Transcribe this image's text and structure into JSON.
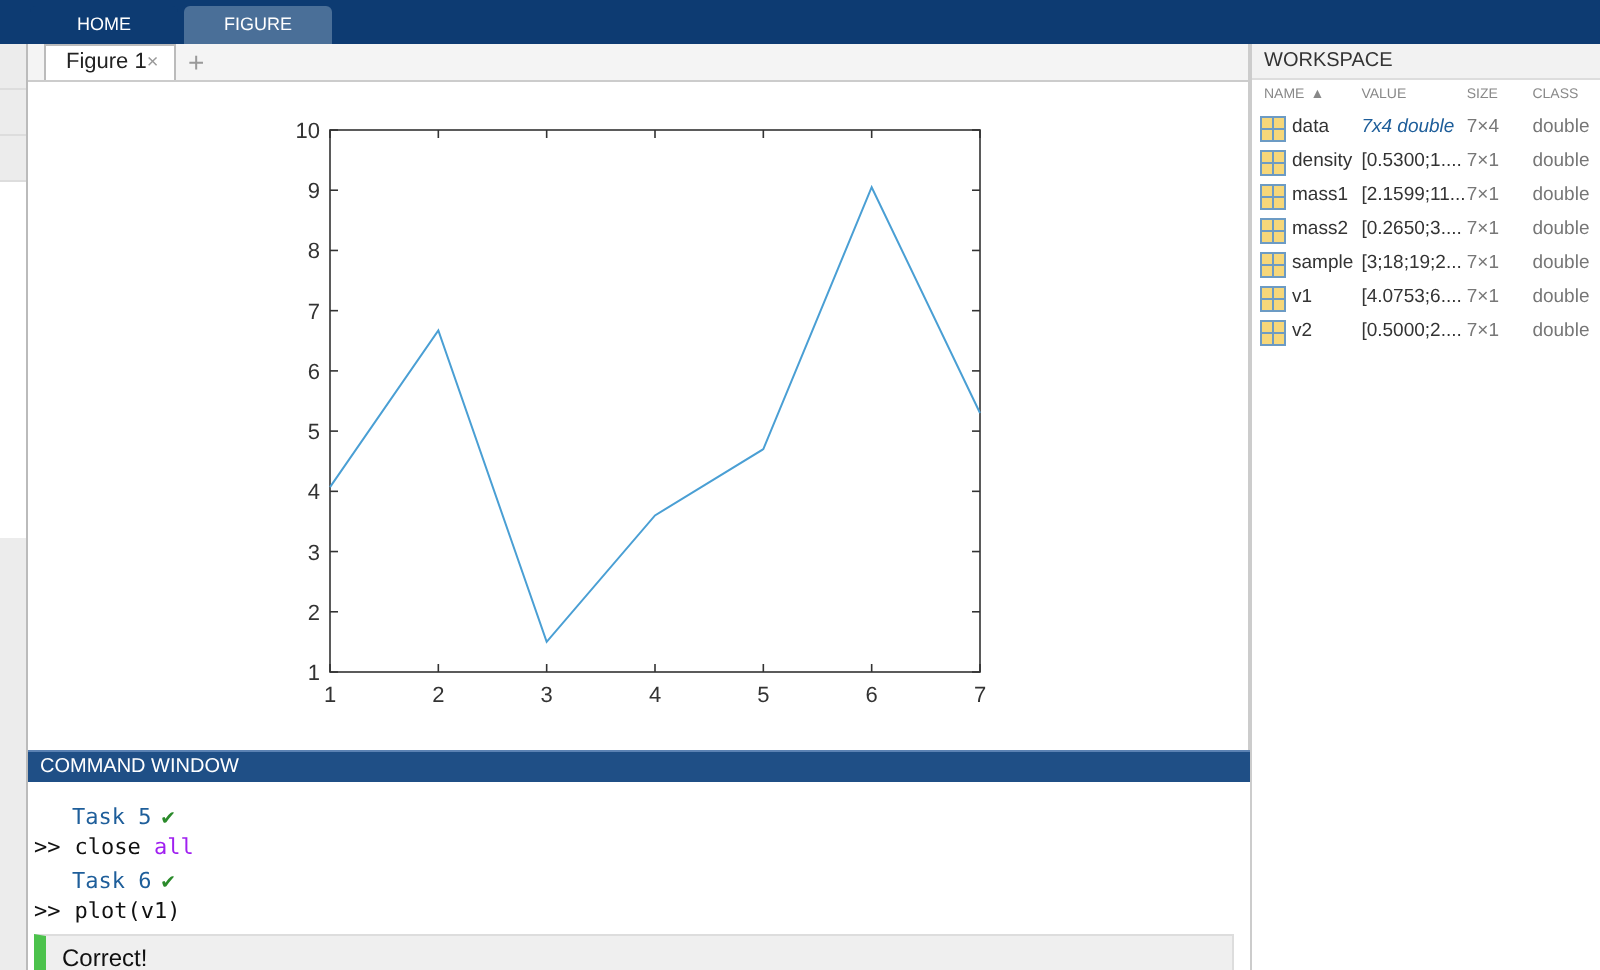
{
  "ribbon_tabs": [
    {
      "label": "HOME",
      "selected": false
    },
    {
      "label": "FIGURE",
      "selected": true
    }
  ],
  "figure_tabs": [
    {
      "label": "Figure 1",
      "selected": true,
      "close": "×"
    }
  ],
  "new_tab": "+",
  "figure": {
    "chart_data": {
      "type": "line",
      "x": [
        1,
        2,
        3,
        4,
        5,
        6,
        7
      ],
      "series": [
        {
          "color": "#4a9fd4",
          "values": [
            4.07,
            6.67,
            1.5,
            3.6,
            4.7,
            9.05,
            5.3
          ]
        }
      ],
      "xlim": [
        1,
        7
      ],
      "ylim": [
        1,
        10
      ],
      "xticks": [
        1,
        2,
        3,
        4,
        5,
        6,
        7
      ],
      "yticks": [
        1,
        2,
        3,
        4,
        5,
        6,
        7,
        8,
        9,
        10
      ]
    }
  },
  "command_window": {
    "title": "COMMAND WINDOW",
    "lines": [
      {
        "kind": "task",
        "text": "Task 5",
        "done": true,
        "mark": "✔"
      },
      {
        "kind": "command",
        "prompt": ">>",
        "segments": [
          {
            "text": "close",
            "kind": "plain"
          },
          {
            "text": "all",
            "kind": "keyword"
          }
        ]
      },
      {
        "kind": "task",
        "text": "Task 6",
        "done": true,
        "mark": "✔"
      },
      {
        "kind": "command",
        "prompt": ">>",
        "segments": [
          {
            "text": "plot(v1)",
            "kind": "plain"
          }
        ]
      }
    ],
    "feedback": {
      "text": "Correct!",
      "success": true
    }
  },
  "workspace": {
    "title": "WORKSPACE",
    "columns": [
      {
        "label": "NAME",
        "sort": "▲"
      },
      {
        "label": "VALUE"
      },
      {
        "label": "SIZE"
      },
      {
        "label": "CLASS"
      }
    ],
    "rows": [
      {
        "name": "data",
        "value": "7x4 double",
        "kind": "summary",
        "size": "7×4",
        "class": "double"
      },
      {
        "name": "density",
        "value": "[0.5300;1....",
        "kind": "array",
        "size": "7×1",
        "class": "double"
      },
      {
        "name": "mass1",
        "value": "[2.1599;11...",
        "kind": "array",
        "size": "7×1",
        "class": "double"
      },
      {
        "name": "mass2",
        "value": "[0.2650;3....",
        "kind": "array",
        "size": "7×1",
        "class": "double"
      },
      {
        "name": "sample",
        "value": "[3;18;19;2...",
        "kind": "array",
        "size": "7×1",
        "class": "double"
      },
      {
        "name": "v1",
        "value": "[4.0753;6....",
        "kind": "array",
        "size": "7×1",
        "class": "double"
      },
      {
        "name": "v2",
        "value": "[0.5000;2....",
        "kind": "array",
        "size": "7×1",
        "class": "double"
      }
    ]
  }
}
